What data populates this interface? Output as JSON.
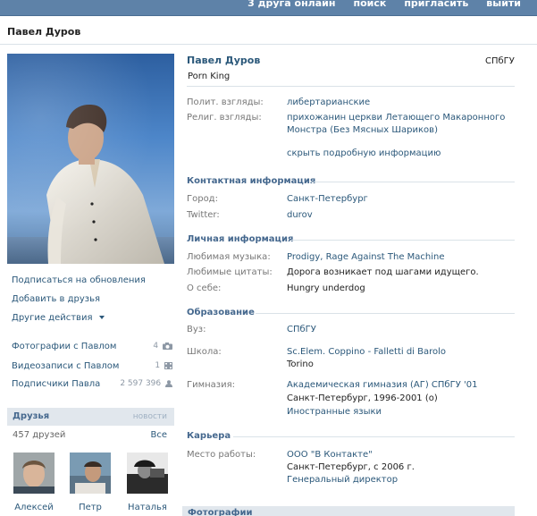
{
  "topbar": {
    "links": [
      "3 друга онлайн",
      "поиск",
      "пригласить",
      "выйти"
    ]
  },
  "page": {
    "title": "Павел Дуров"
  },
  "left": {
    "actions": {
      "subscribe": "Подписаться на обновления",
      "add_friend": "Добавить в друзья",
      "more": "Другие действия"
    },
    "counts": [
      {
        "label": "Фотографии с Павлом",
        "value": "4"
      },
      {
        "label": "Видеозаписи с Павлом",
        "value": "1"
      },
      {
        "label": "Подписчики Павла",
        "value": "2 597 396"
      }
    ],
    "friends": {
      "title": "Друзья",
      "news": "новости",
      "count": "457 друзей",
      "all": "Все",
      "items": [
        "Алексей",
        "Петр",
        "Наталья"
      ]
    }
  },
  "profile": {
    "name": "Павел Дуров",
    "status": "Porn King",
    "university_tag": "СПбГУ",
    "polit_label": "Полит. взгляды:",
    "polit_value": "либертарианские",
    "relig_label": "Религ. взгляды:",
    "relig_value_1": "прихожанин церкви Летающего Макаронного",
    "relig_value_2": "Монстра (Без Мясных Шариков)",
    "hide_info": "скрыть подробную информацию",
    "contacts_title": "Контактная информация",
    "city_label": "Город:",
    "city_value": "Санкт-Петербург",
    "twitter_label": "Twitter:",
    "twitter_value": "durov",
    "personal_title": "Личная информация",
    "music_label": "Любимая музыка:",
    "music_value": "Prodigy, Rage Against The Machine",
    "quotes_label": "Любимые цитаты:",
    "quotes_value": "Дорога возникает под шагами идущего.",
    "about_label": "О себе:",
    "about_value": "Hungry underdog",
    "education_title": "Образование",
    "vuz_label": "Вуз:",
    "vuz_value": "СПбГУ",
    "school_label": "Школа:",
    "school_value_1": "Sc.Elem. Coppino - Falletti di Barolo",
    "school_value_2": "Torino",
    "gym_label": "Гимназия:",
    "gym_value_1": "Академическая гимназия (АГ) СПбГУ '01",
    "gym_value_2": "Санкт-Петербург, 1996-2001 (о)",
    "gym_value_3": "Иностранные языки",
    "career_title": "Карьера",
    "work_label": "Место работы:",
    "work_value_1": "ООО \"В Контакте\"",
    "work_value_2": "Санкт-Петербург, с 2006 г.",
    "work_value_3": "Генеральный директор",
    "photos_title": "Фотографии"
  }
}
